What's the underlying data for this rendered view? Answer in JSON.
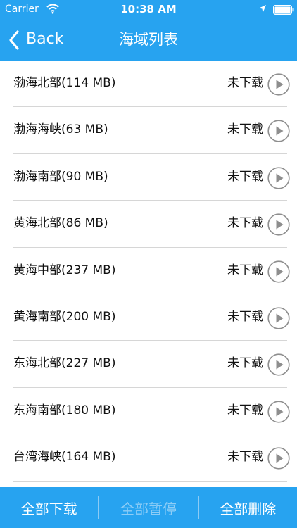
{
  "status_bar": {
    "carrier": "Carrier",
    "time": "10:38 AM"
  },
  "nav": {
    "back_label": "Back",
    "title": "海域列表"
  },
  "items": [
    {
      "name": "渤海北部(114 MB)",
      "status": "未下载"
    },
    {
      "name": "渤海海峡(63 MB)",
      "status": "未下载"
    },
    {
      "name": "渤海南部(90 MB)",
      "status": "未下载"
    },
    {
      "name": "黄海北部(86 MB)",
      "status": "未下载"
    },
    {
      "name": "黄海中部(237 MB)",
      "status": "未下载"
    },
    {
      "name": "黄海南部(200 MB)",
      "status": "未下载"
    },
    {
      "name": "东海北部(227 MB)",
      "status": "未下载"
    },
    {
      "name": "东海南部(180 MB)",
      "status": "未下载"
    },
    {
      "name": "台湾海峡(164 MB)",
      "status": "未下载"
    }
  ],
  "bottom_bar": {
    "download_all": "全部下载",
    "pause_all": "全部暂停",
    "delete_all": "全部删除"
  },
  "colors": {
    "accent": "#27a3f0",
    "disabled_text": "#8ecdf6",
    "icon_gray": "#8e8e8e"
  },
  "icons": {
    "wifi": "wifi-icon",
    "location": "location-arrow-icon",
    "battery": "battery-icon",
    "back": "chevron-left-icon",
    "play": "play-circle-icon"
  }
}
